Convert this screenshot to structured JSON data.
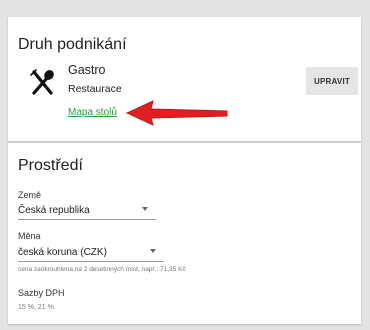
{
  "business": {
    "title": "Druh podnikání",
    "type_name": "Gastro",
    "type_sub": "Restaurace",
    "map_link": "Mapa stolů",
    "edit_button": "UPRAVIT",
    "icon": "cutlery-icon"
  },
  "annotation": {
    "color": "#e02020"
  },
  "environment": {
    "title": "Prostředí",
    "country": {
      "label": "Země",
      "value": "Česká republika"
    },
    "currency": {
      "label": "Měna",
      "value": "česká koruna (CZK)",
      "hint": "cena zaokrouhlena na 2 desetinných míst, např.: 71,35 Kč"
    },
    "vat": {
      "label": "Sazby DPH",
      "values": "15 %, 21 %"
    }
  },
  "colors": {
    "link": "#2e9e3e",
    "background": "#e3e3e3",
    "button": "#e5e5e5"
  }
}
